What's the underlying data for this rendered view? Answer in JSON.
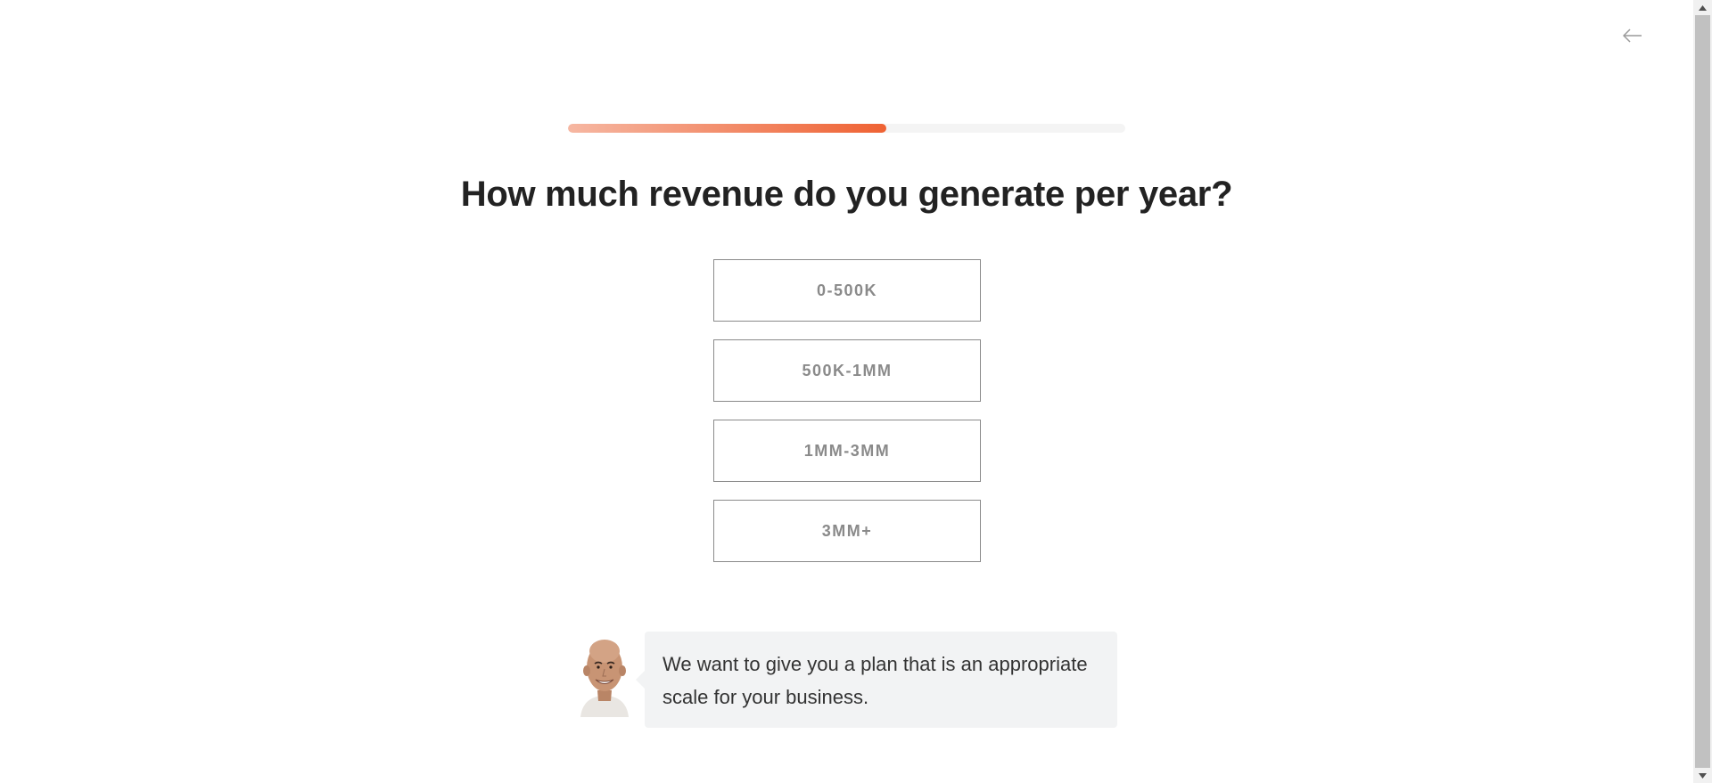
{
  "header": {
    "back_icon": "arrow-left-icon"
  },
  "progress": {
    "fraction": 0.571,
    "colors": {
      "start": "#f6b7a2",
      "end": "#ef6233",
      "track": "#f4f4f4"
    }
  },
  "question": {
    "title": "How much revenue do you generate per year?"
  },
  "options": [
    {
      "label": "0-500K"
    },
    {
      "label": "500K-1MM"
    },
    {
      "label": "1MM-3MM"
    },
    {
      "label": "3MM+"
    }
  ],
  "advisor": {
    "message": "We want to give you a plan that is an appropriate scale for your business."
  }
}
